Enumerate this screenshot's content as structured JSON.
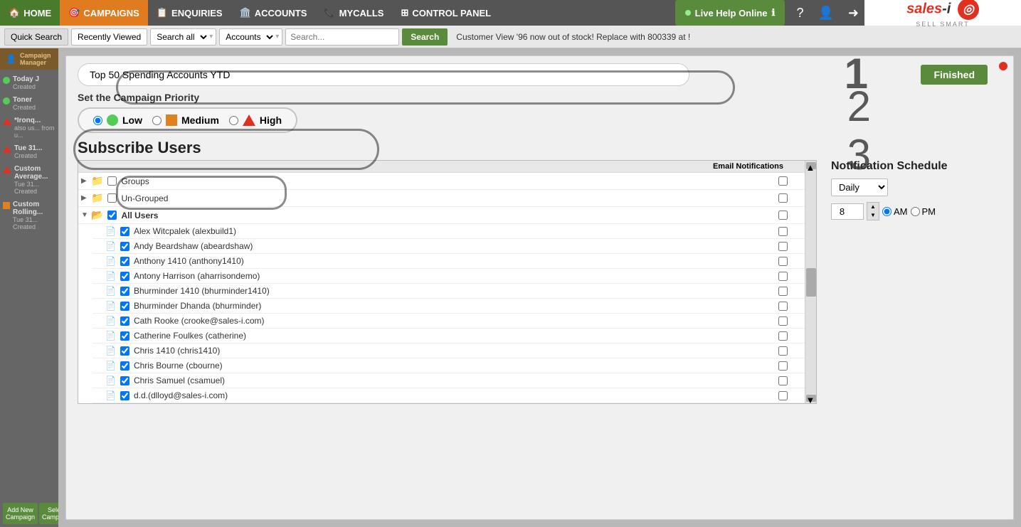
{
  "nav": {
    "home_label": "HOME",
    "campaigns_label": "CAMPAIGNS",
    "enquiries_label": "ENQUIRIES",
    "accounts_label": "ACCOUNTS",
    "mycalls_label": "MYCALLS",
    "control_panel_label": "CONTROL PANEL",
    "live_help_label": "Live Help Online"
  },
  "search_bar": {
    "quick_search": "Quick Search",
    "recently_viewed": "Recently Viewed",
    "search_all": "Search all",
    "accounts": "Accounts",
    "search_placeholder": "Search...",
    "search_btn": "Search",
    "customer_view_text": "Customer View  '96 now out of stock! Replace with 800339 at !"
  },
  "sidebar": {
    "manager_label": "Campaign Manager",
    "items": [
      {
        "label": "Today J",
        "sublabel": "Created",
        "indicator": "green"
      },
      {
        "label": "Toner",
        "sublabel": "Created",
        "indicator": "green"
      },
      {
        "label": "*Ironq...",
        "sublabel": "also us... from u...",
        "indicator": "triangle"
      },
      {
        "label": "Tue 31...",
        "sublabel": "Created",
        "indicator": "triangle"
      },
      {
        "label": "Custom Average...",
        "sublabel": "Tue 31... Created",
        "indicator": "triangle"
      },
      {
        "label": "Custom Rolling...",
        "sublabel": "Tue 31... Created",
        "indicator": "orange"
      }
    ],
    "add_campaign": "Add New Campaign",
    "select_campaign": "Select Campaign"
  },
  "modal": {
    "campaign_name": "Top 50 Spending Accounts YTD",
    "finished_btn": "Finished",
    "priority_title": "Set the Campaign Priority",
    "priority_low": "Low",
    "priority_medium": "Medium",
    "priority_high": "High",
    "subscribe_title": "Subscribe Users",
    "email_notifications": "Email Notifications",
    "notification_schedule_title": "Notification Schedule",
    "frequency": "Daily",
    "time_value": "8",
    "am_label": "AM",
    "pm_label": "PM",
    "step1": "1",
    "step2": "2",
    "step3": "3",
    "users": [
      {
        "indent": 1,
        "type": "folder",
        "collapsed": true,
        "checked": false,
        "label": "Groups",
        "email": false
      },
      {
        "indent": 1,
        "type": "folder",
        "collapsed": true,
        "checked": false,
        "label": "Un-Grouped",
        "email": false
      },
      {
        "indent": 1,
        "type": "folder",
        "collapsed": false,
        "checked": true,
        "label": "All Users",
        "email": false
      },
      {
        "indent": 2,
        "type": "file",
        "collapsed": false,
        "checked": true,
        "label": "Alex Witcpalek (alexbuild1)",
        "email": false
      },
      {
        "indent": 2,
        "type": "file",
        "collapsed": false,
        "checked": true,
        "label": "Andy Beardshaw (abeardshaw)",
        "email": false
      },
      {
        "indent": 2,
        "type": "file",
        "collapsed": false,
        "checked": true,
        "label": "Anthony 1410 (anthony1410)",
        "email": false
      },
      {
        "indent": 2,
        "type": "file",
        "collapsed": false,
        "checked": true,
        "label": "Antony Harrison (aharrisondemo)",
        "email": false
      },
      {
        "indent": 2,
        "type": "file",
        "collapsed": false,
        "checked": true,
        "label": "Bhurminder 1410 (bhurminder1410)",
        "email": false
      },
      {
        "indent": 2,
        "type": "file",
        "collapsed": false,
        "checked": true,
        "label": "Bhurminder Dhanda (bhurminder)",
        "email": false
      },
      {
        "indent": 2,
        "type": "file",
        "collapsed": false,
        "checked": true,
        "label": "Cath Rooke (crooke@sales-i.com)",
        "email": false
      },
      {
        "indent": 2,
        "type": "file",
        "collapsed": false,
        "checked": true,
        "label": "Catherine Foulkes (catherine)",
        "email": false
      },
      {
        "indent": 2,
        "type": "file",
        "collapsed": false,
        "checked": true,
        "label": "Chris  1410 (chris1410)",
        "email": false
      },
      {
        "indent": 2,
        "type": "file",
        "collapsed": false,
        "checked": true,
        "label": "Chris Bourne (cbourne)",
        "email": false
      },
      {
        "indent": 2,
        "type": "file",
        "collapsed": false,
        "checked": true,
        "label": "Chris Samuel (csamuel)",
        "email": false
      },
      {
        "indent": 2,
        "type": "file",
        "collapsed": false,
        "checked": true,
        "label": "d.d.(dlloyd@sales-i.com)",
        "email": false
      }
    ]
  },
  "logo": {
    "text": "sales-i",
    "tagline": "SELL SMART"
  }
}
